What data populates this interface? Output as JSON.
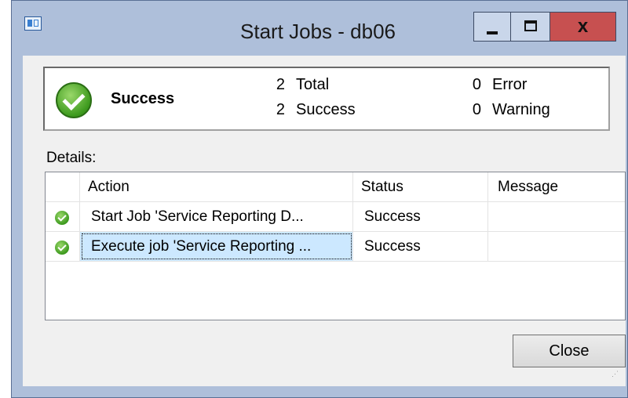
{
  "window": {
    "title": "Start Jobs - db06",
    "app_icon": "dialog-icon",
    "controls": {
      "minimize": "minimize-icon",
      "maximize": "maximize-icon",
      "close": "x"
    },
    "colors": {
      "frame": "#aebfda",
      "close": "#c75050",
      "body": "#f0f0f0"
    }
  },
  "summary": {
    "status": "Success",
    "status_icon": "success-check-icon",
    "total_count": "2",
    "total_label": "Total",
    "success_count": "2",
    "success_label": "Success",
    "error_count": "0",
    "error_label": "Error",
    "warning_count": "0",
    "warning_label": "Warning"
  },
  "details": {
    "label": "Details:",
    "columns": [
      "Action",
      "Status",
      "Message"
    ],
    "rows": [
      {
        "icon": "success-check-icon",
        "action": "Start Job 'Service Reporting D...",
        "status": "Success",
        "message": ""
      },
      {
        "icon": "success-check-icon",
        "action": "Execute job 'Service Reporting ...",
        "status": "Success",
        "message": "",
        "selected": true
      }
    ]
  },
  "buttons": {
    "close": "Close"
  }
}
